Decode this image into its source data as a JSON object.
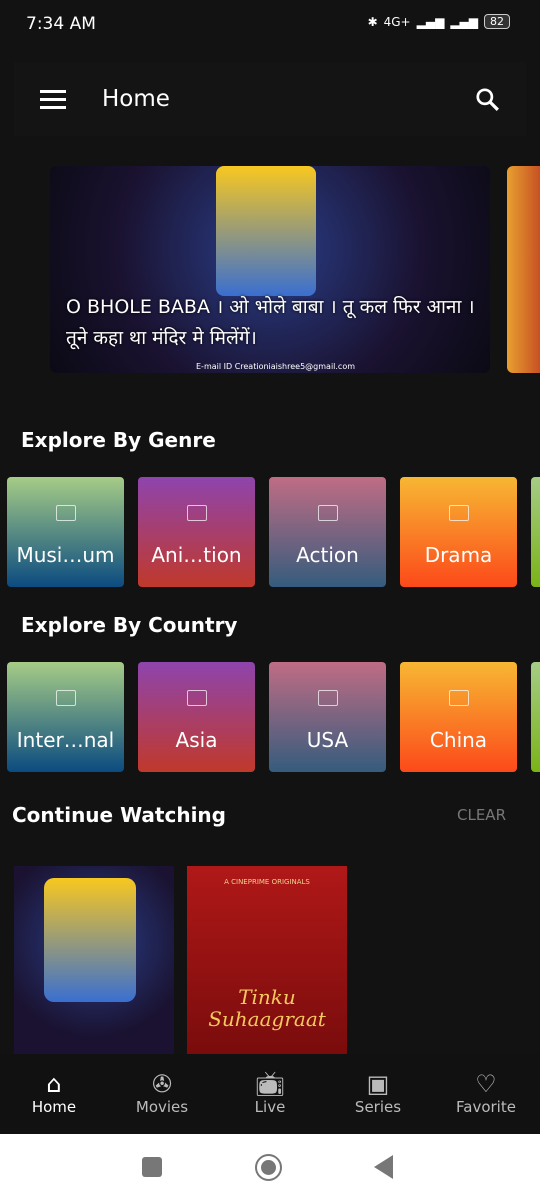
{
  "status": {
    "time": "7:34 AM",
    "network": "4G+",
    "battery": "82"
  },
  "appbar": {
    "title": "Home"
  },
  "banner": {
    "title": "O BHOLE BABA । ओ भोले बाबा । तू कल फिर आना । तूने कहा था मंदिर मे मिलेंगें।",
    "email": "E-mail ID  Creationiaishree5@gmail.com"
  },
  "genre": {
    "heading": "Explore By Genre",
    "items": [
      {
        "label": "Musi…um",
        "colors": [
          "#a6cc86",
          "#0b4b80"
        ]
      },
      {
        "label": "Ani…tion",
        "colors": [
          "#8e44ad",
          "#c0392b"
        ]
      },
      {
        "label": "Action",
        "colors": [
          "#c06c84",
          "#355c7d"
        ]
      },
      {
        "label": "Drama",
        "colors": [
          "#f7b733",
          "#fc4a1a"
        ]
      }
    ]
  },
  "country": {
    "heading": "Explore By Country",
    "items": [
      {
        "label": "Inter…nal",
        "colors": [
          "#a6cc86",
          "#0b4b80"
        ]
      },
      {
        "label": "Asia",
        "colors": [
          "#8e44ad",
          "#c0392b"
        ]
      },
      {
        "label": "USA",
        "colors": [
          "#c06c84",
          "#355c7d"
        ]
      },
      {
        "label": "China",
        "colors": [
          "#f7b733",
          "#fc4a1a"
        ]
      }
    ]
  },
  "continue": {
    "heading": "Continue Watching",
    "clear": "CLEAR",
    "items": [
      {
        "title": ""
      },
      {
        "title": "Tinku Suhaagraat",
        "tag": "A CINEPRIME ORIGINALS"
      }
    ]
  },
  "nav": [
    {
      "label": "Home",
      "icon": "home-icon"
    },
    {
      "label": "Movies",
      "icon": "film-reel-icon"
    },
    {
      "label": "Live",
      "icon": "tv-icon"
    },
    {
      "label": "Series",
      "icon": "film-strip-icon"
    },
    {
      "label": "Favorite",
      "icon": "heart-icon"
    }
  ]
}
